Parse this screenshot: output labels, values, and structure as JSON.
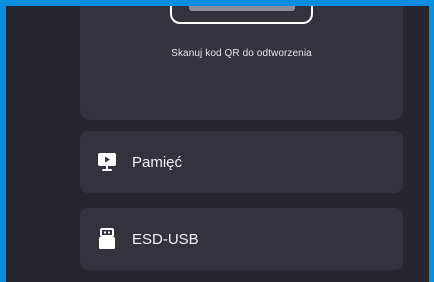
{
  "qr": {
    "caption": "Skanuj kod QR do odtworzenia"
  },
  "menu": {
    "items": [
      {
        "label": "Pamięć",
        "icon": "media-player-icon"
      },
      {
        "label": "ESD-USB",
        "icon": "usb-drive-icon"
      }
    ]
  },
  "colors": {
    "accent_border": "#0a8fe0",
    "background": "#27262f",
    "card": "#34333d",
    "text": "#f2f2f4"
  }
}
